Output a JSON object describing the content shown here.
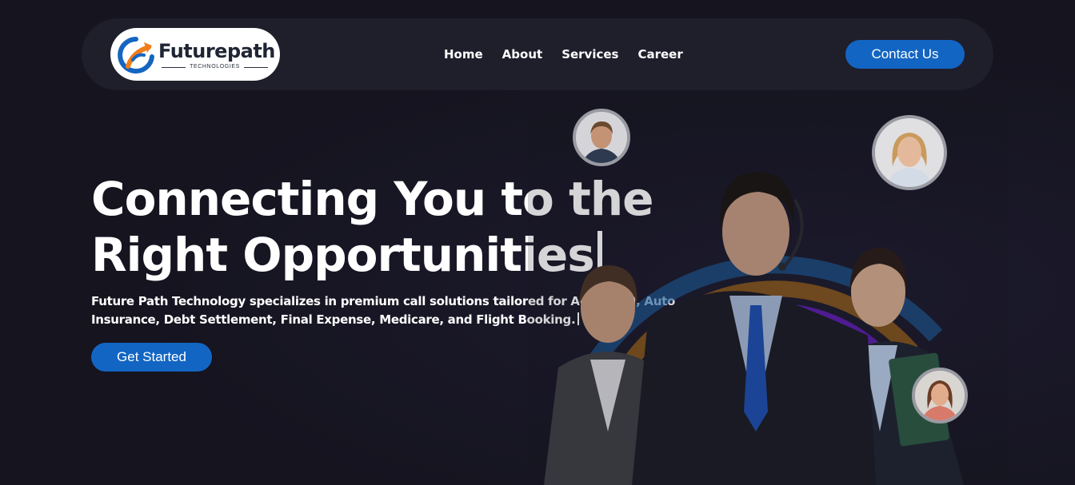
{
  "header": {
    "logo": {
      "name": "Futurepath",
      "tagline": "TECHNOLOGIES"
    },
    "nav": [
      {
        "label": "Home"
      },
      {
        "label": "About"
      },
      {
        "label": "Services"
      },
      {
        "label": "Career"
      }
    ],
    "contact_label": "Contact Us"
  },
  "hero": {
    "title_line1": "Connecting You to the",
    "title_line2": "Right Opportunities",
    "subtitle": "Future Path Technology specializes in premium call solutions tailored for ACA, SSDI, Auto Insurance, Debt Settlement, Final Expense, Medicare, and Flight Booking.",
    "cta_label": "Get Started"
  },
  "colors": {
    "background": "#15141f",
    "navbar": "#1f1e2b",
    "accent": "#1265c3",
    "arc_blue": "#1c6db8",
    "arc_orange": "#c77a14",
    "arc_purple": "#6c1fc9"
  },
  "icons": {
    "logo_mark": "swoosh-arrow-icon"
  }
}
